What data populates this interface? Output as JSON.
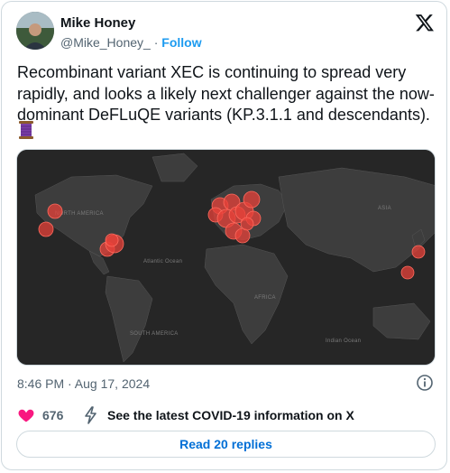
{
  "author": {
    "name": "Mike Honey",
    "handle": "@Mike_Honey_",
    "separator": "·",
    "follow_label": "Follow"
  },
  "tweet": {
    "text": "Recombinant variant XEC is continuing to spread very\nrapidly, and looks a likely next challenger against the now-\ndominant DeFLuQE variants (KP.3.1.1 and descendants).",
    "emoji_icon": "thread-spool-icon"
  },
  "map": {
    "labels": {
      "north_america": "NORTH AMERICA",
      "atlantic": "Atlantic Ocean",
      "asia": "ASIA",
      "africa": "AFRICA",
      "south_america": "SOUTH AMERICA",
      "indian": "Indian Ocean"
    },
    "marker_color": "#e8413a"
  },
  "meta": {
    "timestamp": "8:46 PM · Aug 17, 2024"
  },
  "actions": {
    "like_count": "676",
    "covid_link": "See the latest COVID-19 information on X"
  },
  "replies_button": "Read 20 replies"
}
